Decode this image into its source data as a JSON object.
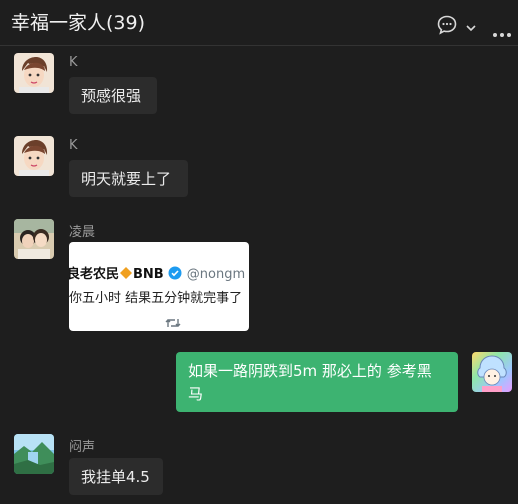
{
  "header": {
    "title": "幸福一家人(39)",
    "chat_icon": "chat-bubble-icon",
    "chevron_icon": "chevron-down-icon",
    "more_icon": "more-horizontal-icon"
  },
  "messages": [
    {
      "sender": "K",
      "text": "预感很强"
    },
    {
      "sender": "K",
      "text": "明天就要上了"
    },
    {
      "sender": "凌晨",
      "card": {
        "author": "良老农民",
        "badge": "BNB",
        "handle": "@nongm",
        "text": "你五小时 结果五分钟就完事了",
        "icon": "retweet-icon"
      }
    },
    {
      "sender": "me",
      "text": "如果一路阴跌到5m 那必上的 参考黑马"
    },
    {
      "sender": "闷声",
      "text": "我挂单4.5"
    }
  ],
  "colors": {
    "background": "#1e1e1e",
    "bubble": "#2c2c2c",
    "my_bubble": "#3db371",
    "verified": "#1d9bf0",
    "bnb_diamond": "#f0a020"
  }
}
